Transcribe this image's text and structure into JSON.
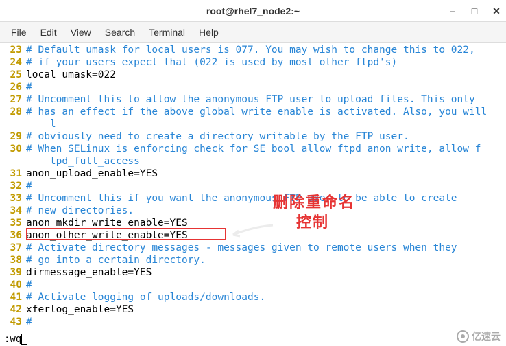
{
  "window": {
    "title": "root@rhel7_node2:~",
    "controls": {
      "minimize": "–",
      "maximize": "□",
      "close": "✕"
    }
  },
  "menu": {
    "file": "File",
    "edit": "Edit",
    "view": "View",
    "search": "Search",
    "terminal": "Terminal",
    "help": "Help"
  },
  "lines": {
    "l23n": "23",
    "l23t": "# Default umask for local users is 077. You may wish to change this to 022,",
    "l24n": "24",
    "l24t": "# if your users expect that (022 is used by most other ftpd's)",
    "l25n": "25",
    "l25t": "local_umask=022",
    "l26n": "26",
    "l26t": "#",
    "l27n": "27",
    "l27t": "# Uncomment this to allow the anonymous FTP user to upload files. This only",
    "l28n": "28",
    "l28t": "# has an effect if the above global write enable is activated. Also, you will",
    "l28c": "    l",
    "l29n": "29",
    "l29t": "# obviously need to create a directory writable by the FTP user.",
    "l30n": "30",
    "l30t": "# When SELinux is enforcing check for SE bool allow_ftpd_anon_write, allow_f",
    "l30c": "    tpd_full_access",
    "l31n": "31",
    "l31t": "anon_upload_enable=YES",
    "l32n": "32",
    "l32t": "#",
    "l33n": "33",
    "l33t": "# Uncomment this if you want the anonymous FTP user to be able to create",
    "l34n": "34",
    "l34t": "# new directories.",
    "l35n": "35",
    "l35t": "anon_mkdir_write_enable=YES",
    "l36n": "36",
    "l36t": "anon_other_write_enable=YES",
    "l37n": "37",
    "l37t": "# Activate directory messages - messages given to remote users when they",
    "l38n": "38",
    "l38t": "# go into a certain directory.",
    "l39n": "39",
    "l39t": "dirmessage_enable=YES",
    "l40n": "40",
    "l40t": "#",
    "l41n": "41",
    "l41t": "# Activate logging of uploads/downloads.",
    "l42n": "42",
    "l42t": "xferlog_enable=YES",
    "l43n": "43",
    "l43t": "#"
  },
  "annotation": {
    "line1": "删除重命名",
    "line2": "控制"
  },
  "command": ":wq",
  "watermark": "亿速云"
}
